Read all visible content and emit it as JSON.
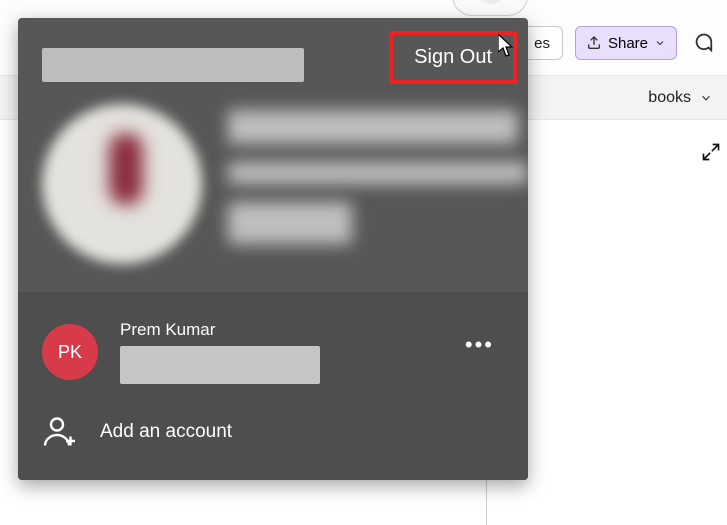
{
  "toolbar": {
    "fragment_label": "es",
    "share_label": "Share"
  },
  "secondary": {
    "dropdown_fragment": "books"
  },
  "panel": {
    "sign_out_label": "Sign Out",
    "other_account": {
      "initials": "PK",
      "name": "Prem Kumar"
    },
    "add_account_label": "Add an account"
  }
}
